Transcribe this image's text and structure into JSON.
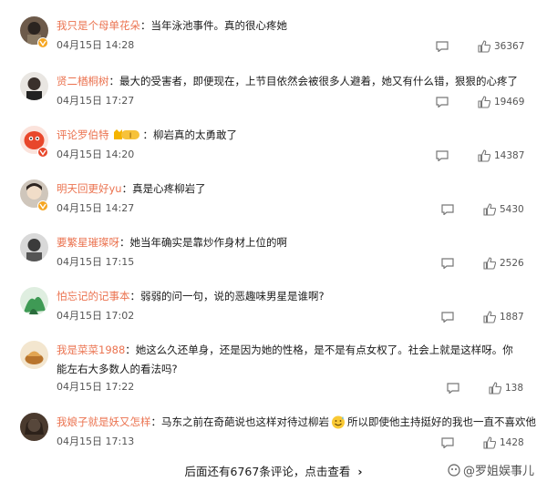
{
  "comments": [
    {
      "name": "我只是个母单花朵",
      "text": "当年泳池事件。真的很心疼她",
      "time": "04月15日 14:28",
      "likes": "36367"
    },
    {
      "name": "贤二楢桐树",
      "text": "最大的受害者，即便现在，上节目依然会被很多人避着，她又有什么错，狠狠的心疼了",
      "time": "04月15日 17:27",
      "likes": "19469"
    },
    {
      "name": "评论罗伯特",
      "level": "I",
      "text": "柳岩真的太勇敢了",
      "time": "04月15日 14:20",
      "likes": "14387"
    },
    {
      "name": "明天回更好yu",
      "text": "真是心疼柳岩了",
      "time": "04月15日 14:27",
      "likes": "5430"
    },
    {
      "name": "要繁星璀璨呀",
      "text": "她当年确实是靠炒作身材上位的啊",
      "time": "04月15日 17:15",
      "likes": "2526"
    },
    {
      "name": "怕忘记的记事本",
      "text": "弱弱的问一句，说的恶趣味男星是谁啊?",
      "time": "04月15日 17:02",
      "likes": "1887"
    },
    {
      "name": "我是菜菜1988",
      "text": "她这么久还单身，还是因为她的性格，是不是有点女权了。社会上就是这样呀。你能左右大多数人的看法吗?",
      "time": "04月15日 17:22",
      "likes": "138"
    },
    {
      "name": "我娘子就是妖又怎样",
      "text_before": "马东之前在奇葩说也这样对待过柳岩",
      "text_after": "所以即使他主持挺好的我也一直不喜欢他",
      "time": "04月15日 17:13",
      "likes": "1428"
    }
  ],
  "separator": "：",
  "footer": {
    "more_text": "后面还有6767条评论，点击查看",
    "chevron": "›"
  },
  "watermark": "@罗姐娱事儿",
  "icons": {
    "reply": "comment-icon",
    "like": "thumbs-up-icon",
    "verified": "v-badge-icon",
    "emoji": "sweat-smile-emoji"
  },
  "colors": {
    "name": "#eb7350",
    "text": "#1a1a1a",
    "meta": "#555555",
    "badge": "#f5a623"
  }
}
